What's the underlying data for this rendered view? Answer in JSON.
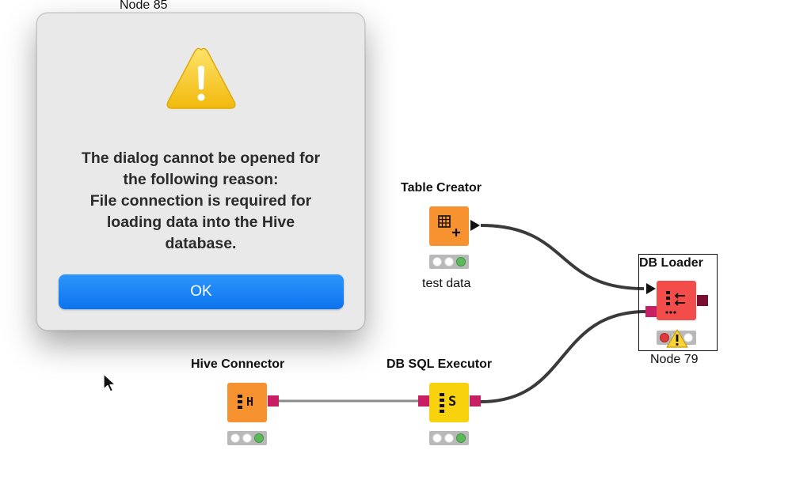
{
  "canvas": {
    "top_node_label": "Node 85"
  },
  "dialog": {
    "message_lines": [
      "The dialog cannot be opened for",
      "the following reason:",
      "File connection is required for",
      "loading data into the Hive",
      "database."
    ],
    "ok_label": "OK",
    "accent_color": "#0b74ee"
  },
  "nodes": {
    "table_creator": {
      "title": "Table Creator",
      "annotation": "test data",
      "color": "#f6922f",
      "icon": "table-plus-icon"
    },
    "db_loader": {
      "title": "DB Loader",
      "annotation": "Node 79",
      "color": "#f24d4a",
      "icon": "db-loader-icon",
      "status": "error-warning"
    },
    "hive_connector": {
      "title": "Hive Connector",
      "color": "#f6922f",
      "icon": "hive-db-icon",
      "icon_text": "H"
    },
    "db_sql_executor": {
      "title": "DB SQL Executor",
      "color": "#f8d20c",
      "icon": "sql-executor-icon",
      "icon_text": "S"
    }
  },
  "colors": {
    "db_port": "#c81e64",
    "connection": "#3a3a3a"
  }
}
